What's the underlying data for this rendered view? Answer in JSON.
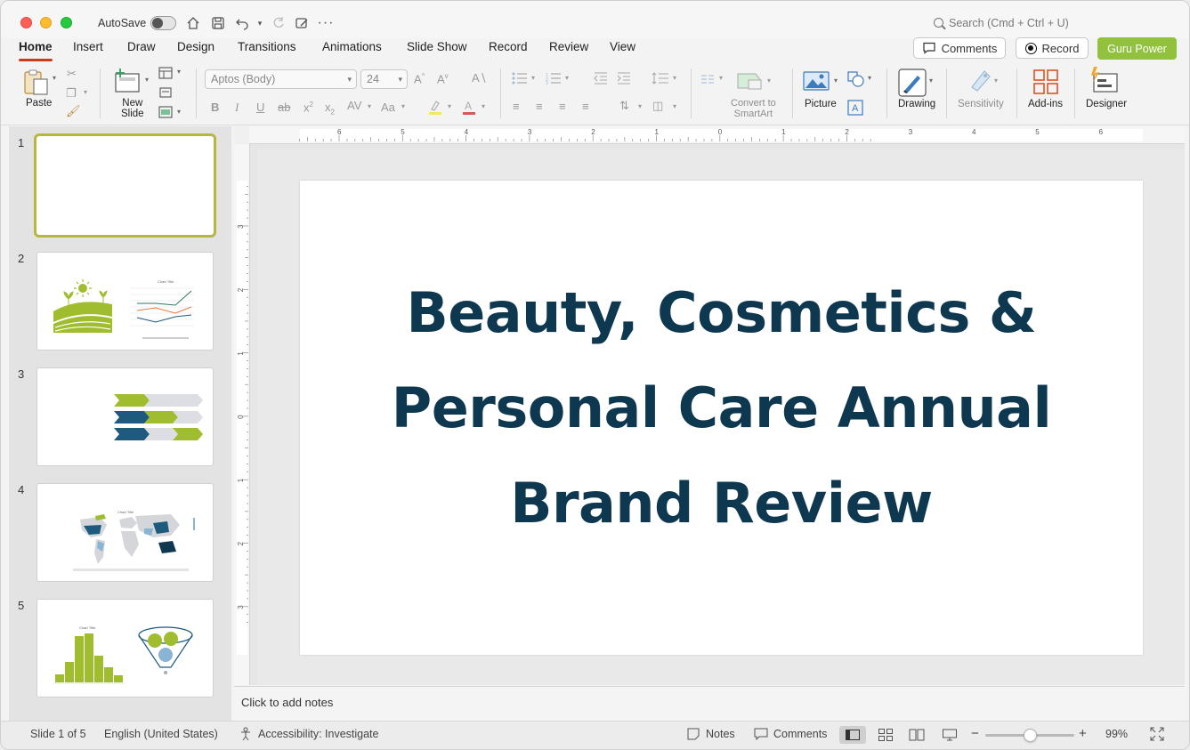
{
  "titlebar": {
    "autosave_label": "AutoSave",
    "autosave_on": false,
    "search_placeholder": "Search (Cmd + Ctrl + U)"
  },
  "tabs": [
    "Home",
    "Insert",
    "Draw",
    "Design",
    "Transitions",
    "Animations",
    "Slide Show",
    "Record",
    "Review",
    "View"
  ],
  "active_tab": "Home",
  "header_buttons": {
    "comments": "Comments",
    "record": "Record",
    "guru": "Guru Power"
  },
  "ribbon": {
    "paste": "Paste",
    "new_slide_line1": "New",
    "new_slide_line2": "Slide",
    "font_name": "Aptos (Body)",
    "font_size": "24",
    "convert_line1": "Convert to",
    "convert_line2": "SmartArt",
    "picture": "Picture",
    "drawing": "Drawing",
    "sensitivity": "Sensitivity",
    "addins": "Add-ins",
    "designer": "Designer"
  },
  "thumbnails": [
    {
      "number": "1"
    },
    {
      "number": "2"
    },
    {
      "number": "3"
    },
    {
      "number": "4"
    },
    {
      "number": "5"
    }
  ],
  "selected_slide": 1,
  "slide": {
    "title_line1": "Beauty, Cosmetics &",
    "title_line2": "Personal Care Annual",
    "title_line3": "Brand Review"
  },
  "notes_placeholder": "Click to add notes",
  "statusbar": {
    "slide_indicator": "Slide 1 of 5",
    "language": "English (United States)",
    "accessibility": "Accessibility: Investigate",
    "notes": "Notes",
    "comments": "Comments",
    "zoom": "99%",
    "zoom_level": 0.5
  },
  "ruler": {
    "h_labels": [
      "6",
      "5",
      "4",
      "3",
      "2",
      "1",
      "0",
      "1",
      "2",
      "3",
      "4",
      "5",
      "6"
    ],
    "v_labels": [
      "3",
      "2",
      "1",
      "0",
      "1",
      "2",
      "3"
    ]
  },
  "colors": {
    "accent_red": "#c43e1c",
    "guru_green": "#92c13e",
    "title_navy": "#0d3850",
    "thumb_green": "#9fbd2f",
    "thumb_navy": "#1d5a7e"
  }
}
